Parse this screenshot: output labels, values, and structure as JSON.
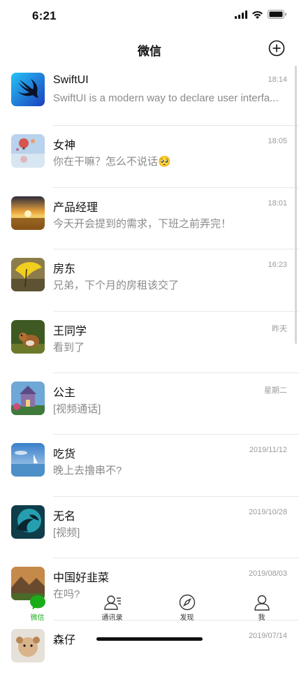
{
  "status": {
    "time": "6:21"
  },
  "nav": {
    "title": "微信"
  },
  "colors": {
    "accent": "#1aad19",
    "secondary_text": "#8a8a8a",
    "divider": "#e7e7e7"
  },
  "chats": [
    {
      "name": "SwiftUI",
      "time": "18:14",
      "message": "SwiftUI is a modern way to declare user interfa...",
      "avatar": "swift-logo"
    },
    {
      "name": "女神",
      "time": "18:05",
      "message": "你在干嘛？怎么不说话🥺",
      "avatar": "hot-air-balloon-photo"
    },
    {
      "name": "产品经理",
      "time": "18:01",
      "message": "今天开会提到的需求，下班之前弄完！",
      "avatar": "sunset-field-photo"
    },
    {
      "name": "房东",
      "time": "16:23",
      "message": "兄弟，下个月的房租该交了",
      "avatar": "yellow-umbrella-photo"
    },
    {
      "name": "王同学",
      "time": "昨天",
      "message": "看到了",
      "avatar": "squirrel-photo"
    },
    {
      "name": "公主",
      "time": "星期二",
      "message": "[视频通话]",
      "avatar": "castle-photo"
    },
    {
      "name": "吃货",
      "time": "2019/11/12",
      "message": "晚上去撸串不?",
      "avatar": "sea-sailboat-photo"
    },
    {
      "name": "无名",
      "time": "2019/10/28",
      "message": "[视频]",
      "avatar": "dragon-photo"
    },
    {
      "name": "中国好韭菜",
      "time": "2019/08/03",
      "message": "在吗?",
      "avatar": "mountain-valley-photo"
    },
    {
      "name": "森仔",
      "time": "2019/07/14",
      "message": "",
      "avatar": "dog-photo"
    }
  ],
  "tabs": [
    {
      "label": "微信",
      "icon": "chat-bubble-icon",
      "active": true
    },
    {
      "label": "通讯录",
      "icon": "contacts-icon",
      "active": false
    },
    {
      "label": "发现",
      "icon": "compass-icon",
      "active": false
    },
    {
      "label": "我",
      "icon": "person-icon",
      "active": false
    }
  ]
}
